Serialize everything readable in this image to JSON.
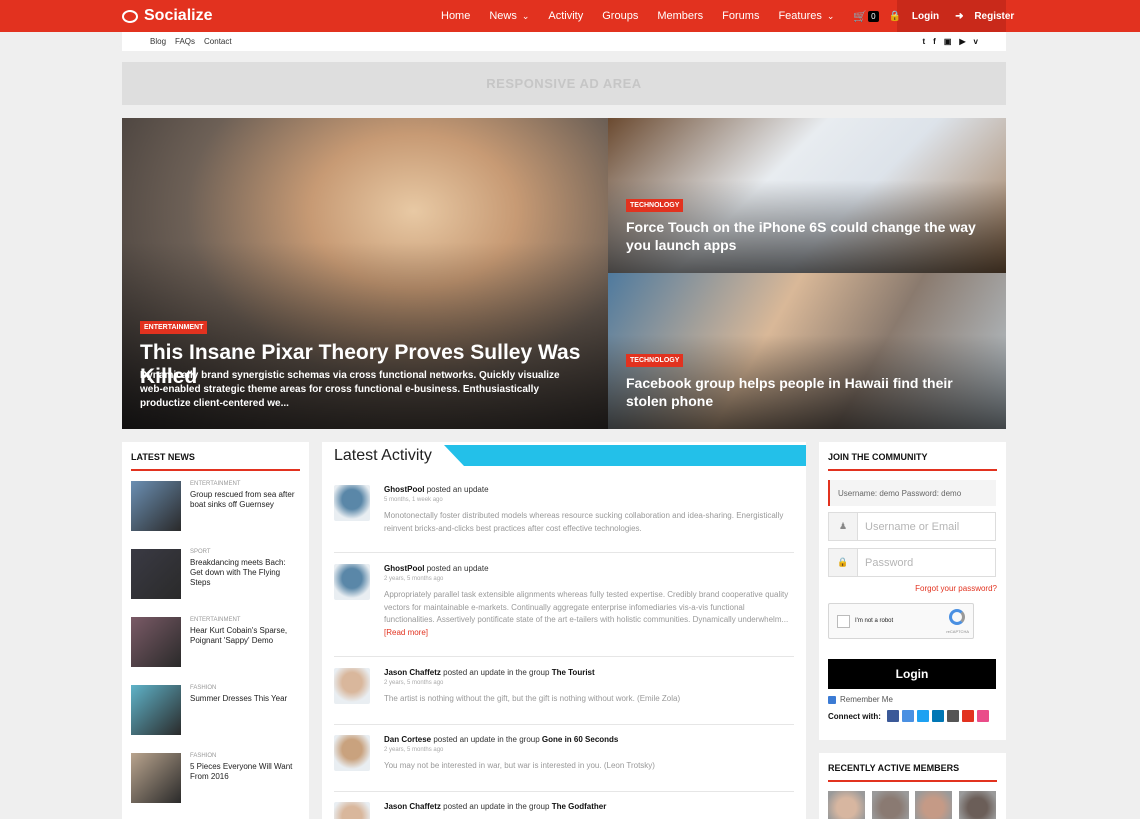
{
  "brand": {
    "name": "Socialize"
  },
  "nav": {
    "items": [
      {
        "label": "Home",
        "dropdown": false
      },
      {
        "label": "News",
        "dropdown": true
      },
      {
        "label": "Activity",
        "dropdown": false
      },
      {
        "label": "Groups",
        "dropdown": false
      },
      {
        "label": "Members",
        "dropdown": false
      },
      {
        "label": "Forums",
        "dropdown": false
      },
      {
        "label": "Features",
        "dropdown": true
      }
    ],
    "cart_count": "0",
    "login_label": "Login",
    "register_label": "Register"
  },
  "subnav": {
    "links": [
      "Blog",
      "FAQs",
      "Contact"
    ],
    "socials": [
      "twitter-icon",
      "facebook-icon",
      "instagram-icon",
      "youtube-icon",
      "vine-icon"
    ]
  },
  "ad": {
    "text": "RESPONSIVE AD AREA"
  },
  "hero": {
    "main": {
      "tag": "ENTERTAINMENT",
      "title": "This Insane Pixar Theory Proves Sulley Was Killed",
      "excerpt": "Dynamically brand synergistic schemas via cross functional networks. Quickly visualize web-enabled strategic theme areas for cross functional e-business. Enthusiastically productize client-centered we..."
    },
    "top": {
      "tag": "TECHNOLOGY",
      "title": "Force Touch on the iPhone 6S could change the way you launch apps"
    },
    "bottom": {
      "tag": "TECHNOLOGY",
      "title": "Facebook group helps people in Hawaii find their stolen phone"
    }
  },
  "latest_news": {
    "heading": "LATEST NEWS",
    "items": [
      {
        "category": "ENTERTAINMENT",
        "title": "Group rescued from sea after boat sinks off Guernsey",
        "thumb_color": "#6b8fb3"
      },
      {
        "category": "SPORT",
        "title": "Breakdancing meets Bach: Get down with The Flying Steps",
        "thumb_color": "#3a3a44"
      },
      {
        "category": "ENTERTAINMENT",
        "title": "Hear Kurt Cobain's Sparse, Poignant 'Sappy' Demo",
        "thumb_color": "#7a5a66"
      },
      {
        "category": "FASHION",
        "title": "Summer Dresses This Year",
        "thumb_color": "#5fb3c9"
      },
      {
        "category": "FASHION",
        "title": "5 Pieces Everyone Will Want From 2016",
        "thumb_color": "#b9a48e"
      }
    ]
  },
  "activity": {
    "heading": "Latest Activity",
    "items": [
      {
        "user": "GhostPool",
        "action": "posted an update",
        "group": "",
        "time": "5 months, 1 week ago",
        "text": "Monotonectally foster distributed models whereas resource sucking collaboration and idea-sharing. Energistically reinvent bricks-and-clicks best practices after cost effective technologies.",
        "read_more": "",
        "avatar_color": "#5a87a8"
      },
      {
        "user": "GhostPool",
        "action": "posted an update",
        "group": "",
        "time": "2 years, 5 months ago",
        "text": "Appropriately parallel task extensible alignments whereas fully tested expertise. Credibly brand cooperative quality vectors for maintainable e-markets. Continually aggregate enterprise infomediaries vis-a-vis functional functionalities. Assertively pontificate state of the art e-tailers with holistic communities. Dynamically underwhelm...",
        "read_more": "[Read more]",
        "avatar_color": "#5a87a8"
      },
      {
        "user": "Jason Chaffetz",
        "action": "posted an update in the group",
        "group": "The Tourist",
        "time": "2 years, 5 months ago",
        "text": "The artist is nothing without the gift, but the gift is nothing without work. (Emile Zola)",
        "read_more": "",
        "avatar_color": "#d9b79c"
      },
      {
        "user": "Dan Cortese",
        "action": "posted an update in the group",
        "group": "Gone in 60 Seconds",
        "time": "2 years, 5 months ago",
        "text": "You may not be interested in war, but war is interested in you. (Leon Trotsky)",
        "read_more": "",
        "avatar_color": "#c9a27e"
      },
      {
        "user": "Jason Chaffetz",
        "action": "posted an update in the group",
        "group": "The Godfather",
        "time": "",
        "text": "",
        "read_more": "",
        "avatar_color": "#d9b79c"
      }
    ]
  },
  "login": {
    "heading": "JOIN THE COMMUNITY",
    "hint": "Username: demo   Password: demo",
    "username_placeholder": "Username or Email",
    "password_placeholder": "Password",
    "forgot": "Forgot your password?",
    "captcha_label": "I'm not a robot",
    "captcha_sub": "reCAPTCHA",
    "button": "Login",
    "remember": "Remember Me",
    "connect_label": "Connect with:",
    "connect_networks": [
      {
        "icon": "facebook-icon",
        "color": "#3b5998"
      },
      {
        "icon": "google-icon",
        "color": "#4a90e2"
      },
      {
        "icon": "twitter-icon",
        "color": "#1da1f2"
      },
      {
        "icon": "linkedin-icon",
        "color": "#0077b5"
      },
      {
        "icon": "instagram-icon",
        "color": "#555555"
      },
      {
        "icon": "odnoklassniki-icon",
        "color": "#e2321f"
      },
      {
        "icon": "dribbble-icon",
        "color": "#ea4c89"
      }
    ]
  },
  "members": {
    "heading": "RECENTLY ACTIVE MEMBERS",
    "avatars": [
      "#d7b6a0",
      "#8a7a72",
      "#c59a86",
      "#6b5e58"
    ]
  },
  "colors": {
    "accent": "#e2321f",
    "activity_bar": "#23c0e9",
    "background": "#efefef"
  }
}
